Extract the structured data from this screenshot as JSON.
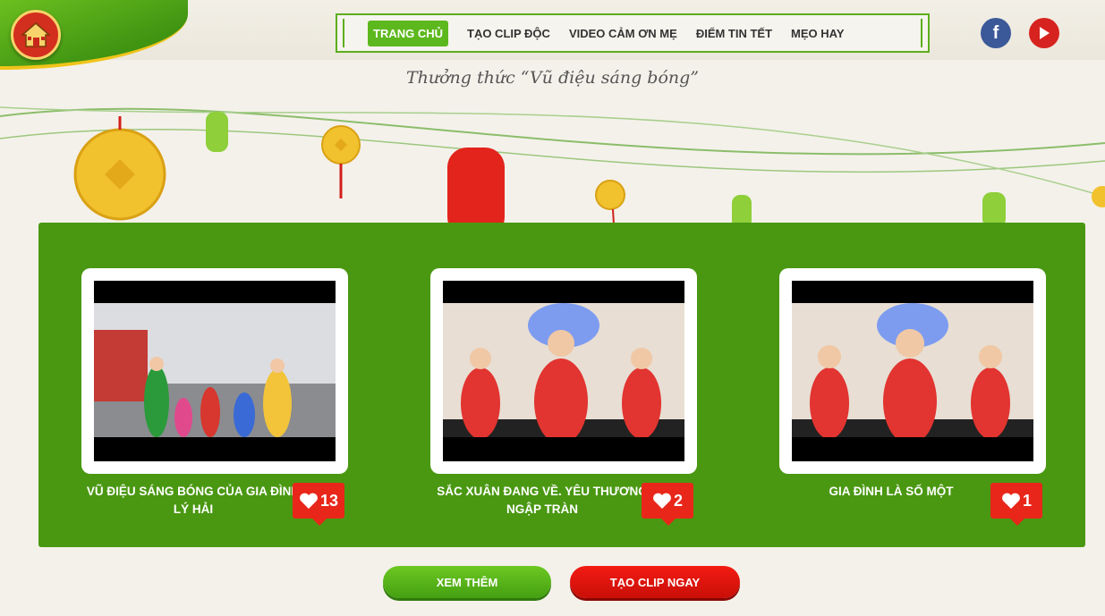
{
  "nav": {
    "items": [
      {
        "label": "TRANG CHỦ",
        "active": true
      },
      {
        "label": "TẠO CLIP ĐỘC",
        "active": false
      },
      {
        "label": "VIDEO CẢM ƠN MẸ",
        "active": false
      },
      {
        "label": "ĐIỂM TIN TẾT",
        "active": false
      },
      {
        "label": "MẸO HAY",
        "active": false
      }
    ]
  },
  "social": {
    "facebook_icon": "facebook-icon",
    "youtube_icon": "youtube-icon"
  },
  "page": {
    "subtitle": "Thưởng thức “Vũ điệu sáng bóng”"
  },
  "videos": [
    {
      "title": "VŨ ĐIỆU SÁNG BÓNG CỦA GIA ĐÌNH LÝ HẢI",
      "likes": "13"
    },
    {
      "title": "SẮC XUÂN ĐANG VỀ. YÊU THƯƠNG NGẬP TRÀN",
      "likes": "2"
    },
    {
      "title": "GIA ĐÌNH LÀ SỐ MỘT",
      "likes": "1"
    }
  ],
  "buttons": {
    "more": "XEM THÊM",
    "create": "TẠO CLIP NGAY"
  },
  "colors": {
    "brand_green": "#4a9812",
    "accent_red": "#e8261a",
    "nav_active": "#5db81d"
  }
}
